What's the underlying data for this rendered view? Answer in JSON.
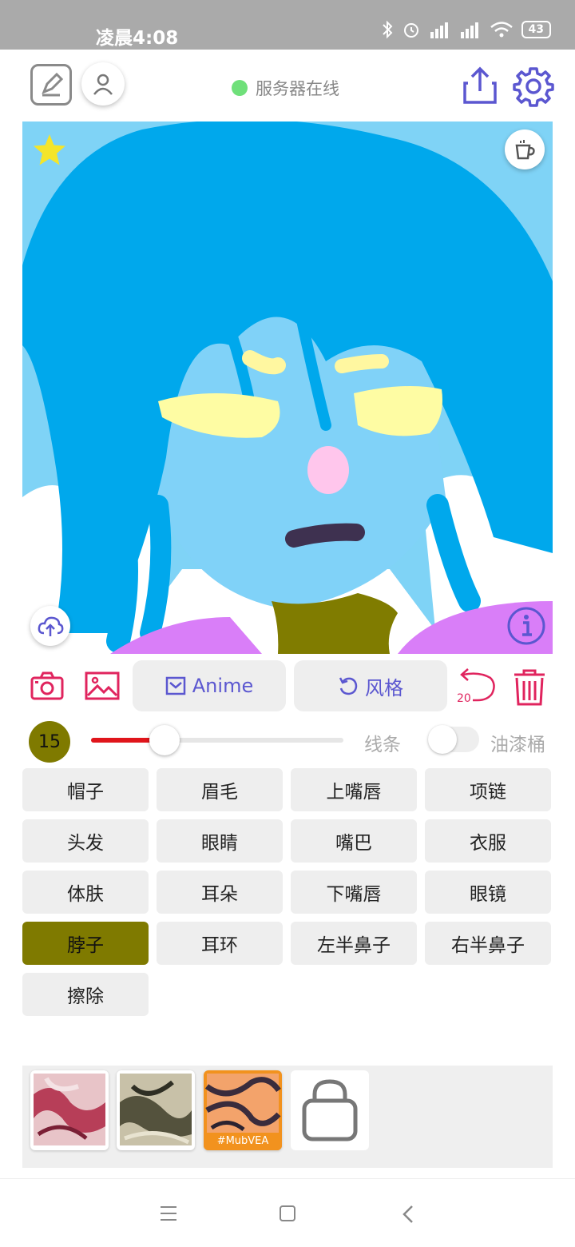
{
  "status_bar": {
    "time": "凌晨4:08",
    "battery": "43"
  },
  "header": {
    "server_status": "服务器在线",
    "server_status_color": "#6fe07a"
  },
  "toolbar": {
    "model_label": "Anime",
    "style_label": "风格",
    "undo_count": "20"
  },
  "brush": {
    "size": "15",
    "size_fraction": 0.29,
    "line_label": "线条",
    "bucket_label": "油漆桶",
    "bucket_on": false,
    "brush_color": "#e0151b"
  },
  "parts": [
    "帽子",
    "眉毛",
    "上嘴唇",
    "项链",
    "头发",
    "眼睛",
    "嘴巴",
    "衣服",
    "体肤",
    "耳朵",
    "下嘴唇",
    "眼镜",
    "脖子",
    "耳环",
    "左半鼻子",
    "右半鼻子",
    "擦除"
  ],
  "selected_part": "脖子",
  "selected_part_color": "#7f7a00",
  "styles": [
    {
      "name": "style-1",
      "tag": ""
    },
    {
      "name": "style-2",
      "tag": ""
    },
    {
      "name": "style-3",
      "tag": "#MubVEA",
      "selected": true
    }
  ],
  "accent_color": "#5b57d0",
  "danger_color": "#e0245e"
}
